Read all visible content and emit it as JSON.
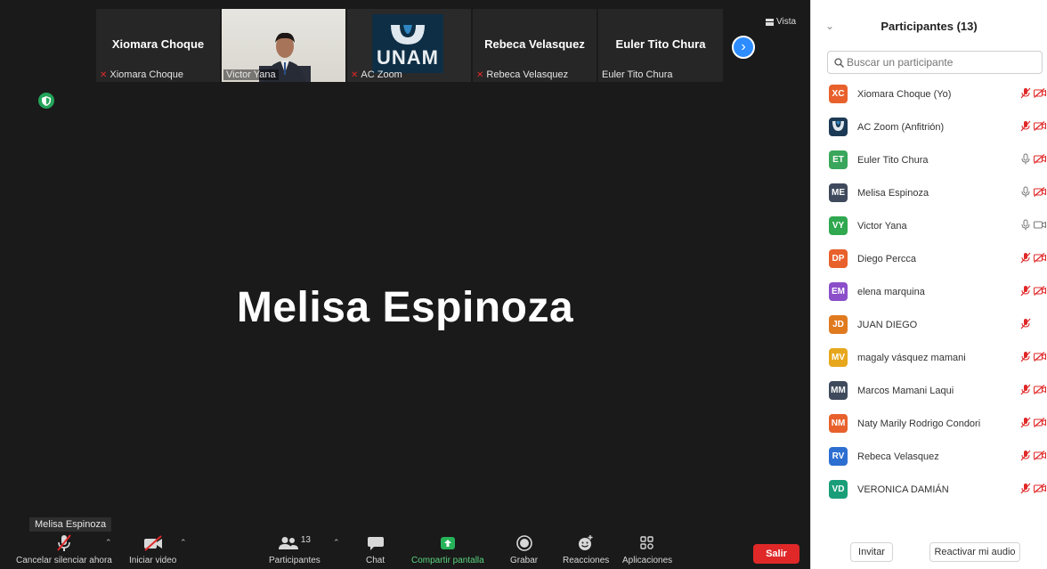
{
  "thumbnails": [
    {
      "name": "Xiomara Choque",
      "label": "Xiomara Choque",
      "muted": true,
      "type": "name"
    },
    {
      "name": "",
      "label": "Victor Yana",
      "muted": false,
      "type": "video"
    },
    {
      "name": "",
      "label": "AC Zoom",
      "muted": true,
      "type": "logo"
    },
    {
      "name": "Rebeca Velasquez",
      "label": "Rebeca Velasquez",
      "muted": true,
      "type": "name"
    },
    {
      "name": "Euler Tito Chura",
      "label": "Euler Tito Chura",
      "muted": false,
      "type": "name"
    }
  ],
  "logo_text": "UNAM",
  "view_label": "Vista",
  "active_speaker": "Melisa Espinoza",
  "speaker_tag": "Melisa Espinoza",
  "toolbar": {
    "unmute_label": "Cancelar silenciar ahora",
    "video_label": "Iniciar video",
    "participants_label": "Participantes",
    "participants_count": "13",
    "chat_label": "Chat",
    "share_label": "Compartir pantalla",
    "record_label": "Grabar",
    "reactions_label": "Reacciones",
    "apps_label": "Aplicaciones",
    "leave_label": "Salir"
  },
  "panel": {
    "title": "Participantes (13)",
    "search_placeholder": "Buscar un participante",
    "invite_label": "Invitar",
    "reactivate_audio_label": "Reactivar mi audio"
  },
  "participants": [
    {
      "initials": "XC",
      "name": "Xiomara Choque (Yo)",
      "color": "#e8612c",
      "mic": "muted",
      "cam": "off"
    },
    {
      "initials": "",
      "name": "AC Zoom (Anfitrión)",
      "color": "#1c3a55",
      "mic": "muted",
      "cam": "off"
    },
    {
      "initials": "ET",
      "name": "Euler Tito Chura",
      "color": "#3aa65c",
      "mic": "on",
      "cam": "off"
    },
    {
      "initials": "ME",
      "name": "Melisa Espinoza",
      "color": "#3f4a5c",
      "mic": "on",
      "cam": "off"
    },
    {
      "initials": "VY",
      "name": "Victor Yana",
      "color": "#2fa84f",
      "mic": "on",
      "cam": "on"
    },
    {
      "initials": "DP",
      "name": "Diego Percca",
      "color": "#e8612c",
      "mic": "muted",
      "cam": "off"
    },
    {
      "initials": "EM",
      "name": "elena marquina",
      "color": "#8a4fc9",
      "mic": "muted",
      "cam": "off"
    },
    {
      "initials": "JD",
      "name": "JUAN DIEGO",
      "color": "#e07a1f",
      "mic": "muted",
      "cam": "none"
    },
    {
      "initials": "MV",
      "name": "magaly vásquez mamani",
      "color": "#e7a71c",
      "mic": "muted",
      "cam": "off"
    },
    {
      "initials": "MM",
      "name": "Marcos Mamani Laqui",
      "color": "#3f4a5c",
      "mic": "muted",
      "cam": "off"
    },
    {
      "initials": "NM",
      "name": "Naty Marily Rodrigo Condori",
      "color": "#e8612c",
      "mic": "muted",
      "cam": "off"
    },
    {
      "initials": "RV",
      "name": "Rebeca Velasquez",
      "color": "#2d6fd1",
      "mic": "muted",
      "cam": "off"
    },
    {
      "initials": "VD",
      "name": "VERONICA DAMIÁN",
      "color": "#1a9e7a",
      "mic": "muted",
      "cam": "off"
    }
  ]
}
